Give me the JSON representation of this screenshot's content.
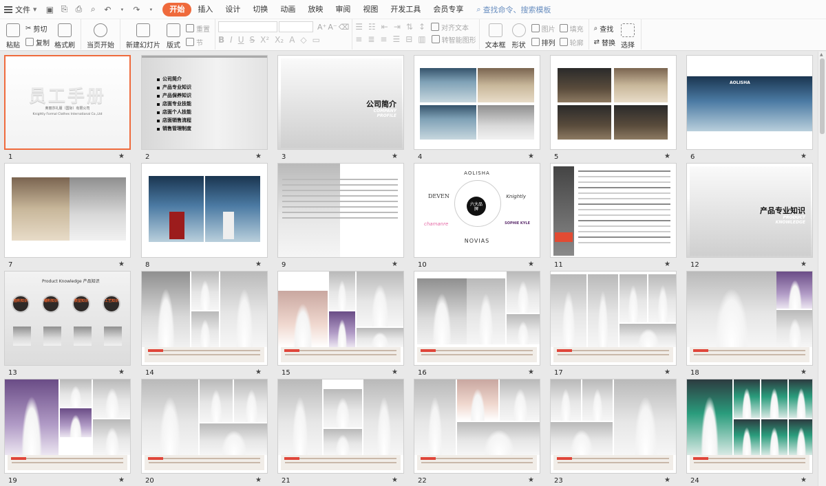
{
  "menu": {
    "file_label": "文件",
    "tabs": [
      "开始",
      "插入",
      "设计",
      "切换",
      "动画",
      "放映",
      "审阅",
      "视图",
      "开发工具",
      "会员专享"
    ],
    "active_tab": "开始",
    "search_placeholder": "查找命令、搜索模板"
  },
  "ribbon": {
    "paste": "粘贴",
    "cut": "剪切",
    "copy": "复制",
    "format_painter": "格式刷",
    "from_current": "当页开始",
    "new_slide": "新建幻灯片",
    "layout": "版式",
    "reset": "重置",
    "section": "节",
    "align_text": "对齐文本",
    "smartart": "转智能图形",
    "textbox": "文本框",
    "shapes": "形状",
    "arrange": "排列",
    "picture": "图片",
    "fill": "填充",
    "outline": "轮廓",
    "find": "查找",
    "replace": "替换",
    "select": "选择"
  },
  "slides": [
    {
      "n": "1",
      "title": "员工手册",
      "sub": "奥丽莎礼服（国际）有限公司",
      "sub2": "Knightly Formal Clothes International Co.,Ltd"
    },
    {
      "n": "2",
      "items": [
        "公司简介",
        "产品专业知识",
        "产品保养知识",
        "店面专业技能",
        "店面个人技能",
        "店面销售流程",
        "销售管理制度"
      ]
    },
    {
      "n": "3",
      "title": "公司简介",
      "en": "COMPANY PROFILE"
    },
    {
      "n": "4"
    },
    {
      "n": "5"
    },
    {
      "n": "6",
      "brand": "AOLISHA"
    },
    {
      "n": "7"
    },
    {
      "n": "8"
    },
    {
      "n": "9"
    },
    {
      "n": "10",
      "top": "AOLISHA",
      "bottom": "NOVIAS",
      "left": "DEVEN",
      "right": "Knightly",
      "center": "六大品牌",
      "bl": "chamanre",
      "br": "SOPHIE KYLE"
    },
    {
      "n": "11"
    },
    {
      "n": "12",
      "title": "产品专业知识",
      "en": "PRODUCT KNOWLEDGE"
    },
    {
      "n": "13",
      "title": "Product Knowledge 产品知识",
      "circles": [
        "面料知识",
        "辅料知识",
        "款型知识",
        "工艺知识"
      ]
    },
    {
      "n": "14"
    },
    {
      "n": "15"
    },
    {
      "n": "16"
    },
    {
      "n": "17"
    },
    {
      "n": "18"
    },
    {
      "n": "19",
      "brand": "AOLISHA"
    },
    {
      "n": "20"
    },
    {
      "n": "21"
    },
    {
      "n": "22"
    },
    {
      "n": "23"
    },
    {
      "n": "24"
    }
  ],
  "star_glyph": "★"
}
